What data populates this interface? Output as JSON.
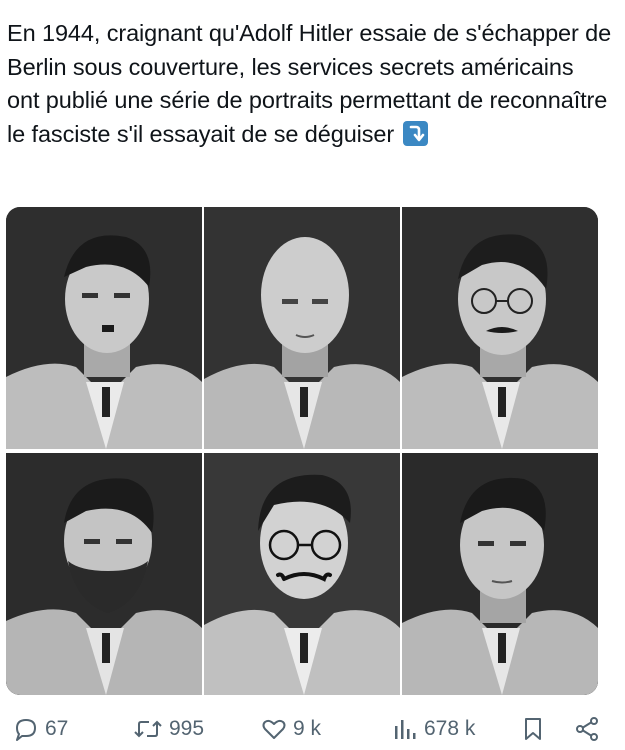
{
  "tweet": {
    "text": "En 1944, craignant qu'Adolf Hitler essaie de s'échapper de Berlin sous couverture, les services secrets américains ont publié une série de portraits permettant de reconnaître le fasciste s'il essayait de se déguiser",
    "emoji_icon": "arrow-down-right-emoji"
  },
  "actions": {
    "replies": "67",
    "reposts": "995",
    "likes": "9 k",
    "views": "678 k",
    "reply_icon": "speech-bubble-icon",
    "repost_icon": "repost-arrows-icon",
    "like_icon": "heart-icon",
    "views_icon": "bar-chart-icon",
    "bookmark_icon": "bookmark-icon",
    "share_icon": "share-icon"
  },
  "colors": {
    "text": "#0f1419",
    "muted": "#536471",
    "emoji_blue": "#3b88c3"
  }
}
